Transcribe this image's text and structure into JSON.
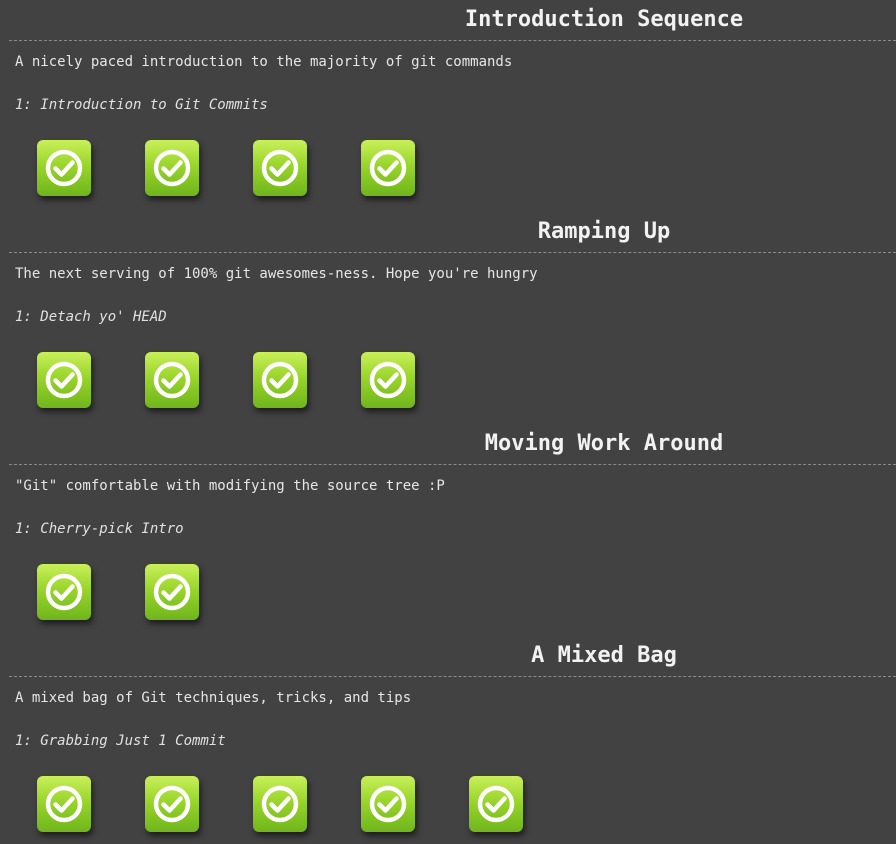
{
  "sections": [
    {
      "title": "Introduction Sequence",
      "description": "A nicely paced introduction to the majority of git commands",
      "current_level": "1: Introduction to Git Commits",
      "levels": [
        {
          "completed": true,
          "icon": "check-circle-icon"
        },
        {
          "completed": true,
          "icon": "check-circle-icon"
        },
        {
          "completed": true,
          "icon": "check-circle-icon"
        },
        {
          "completed": true,
          "icon": "check-circle-icon"
        }
      ]
    },
    {
      "title": "Ramping Up",
      "description": "The next serving of 100% git awesomes-ness. Hope you're hungry",
      "current_level": "1: Detach yo' HEAD",
      "levels": [
        {
          "completed": true,
          "icon": "check-circle-icon"
        },
        {
          "completed": true,
          "icon": "check-circle-icon"
        },
        {
          "completed": true,
          "icon": "check-circle-icon"
        },
        {
          "completed": true,
          "icon": "check-circle-icon"
        }
      ]
    },
    {
      "title": "Moving Work Around",
      "description": "\"Git\" comfortable with modifying the source tree :P",
      "current_level": "1: Cherry-pick Intro",
      "levels": [
        {
          "completed": true,
          "icon": "check-circle-icon"
        },
        {
          "completed": true,
          "icon": "check-circle-icon"
        }
      ]
    },
    {
      "title": "A Mixed Bag",
      "description": "A mixed bag of Git techniques, tricks, and tips",
      "current_level": "1: Grabbing Just 1 Commit",
      "levels": [
        {
          "completed": true,
          "icon": "check-circle-icon"
        },
        {
          "completed": true,
          "icon": "check-circle-icon"
        },
        {
          "completed": true,
          "icon": "check-circle-icon"
        },
        {
          "completed": true,
          "icon": "check-circle-icon"
        },
        {
          "completed": true,
          "icon": "check-circle-icon"
        }
      ]
    }
  ],
  "colors": {
    "background": "#424242",
    "icon_top": "#c9f05a",
    "icon_bottom": "#6fb51c",
    "check": "#ffffff"
  }
}
